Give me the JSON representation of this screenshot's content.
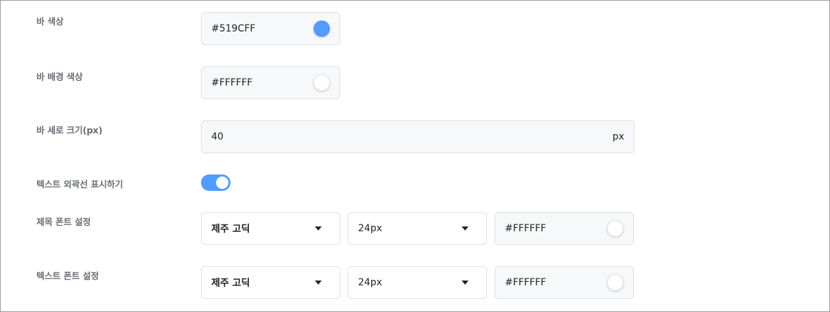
{
  "bar_color": {
    "label": "바 색상",
    "value": "#519CFF",
    "swatch": "#519CFF"
  },
  "bar_bg_color": {
    "label": "바 배경 색상",
    "value": "#FFFFFF",
    "swatch": "#FFFFFF"
  },
  "bar_height": {
    "label": "바 세로 크기(px)",
    "value": "40",
    "unit": "px"
  },
  "text_outline": {
    "label": "텍스트 외곽선 표시하기",
    "enabled": true
  },
  "title_font": {
    "label": "제목 폰트 설정",
    "family": "제주 고딕",
    "size": "24px",
    "color": "#FFFFFF"
  },
  "text_font": {
    "label": "텍스트 폰트 설정",
    "family": "제주 고딕",
    "size": "24px",
    "color": "#FFFFFF"
  },
  "colors": {
    "accent": "#519CFF"
  }
}
